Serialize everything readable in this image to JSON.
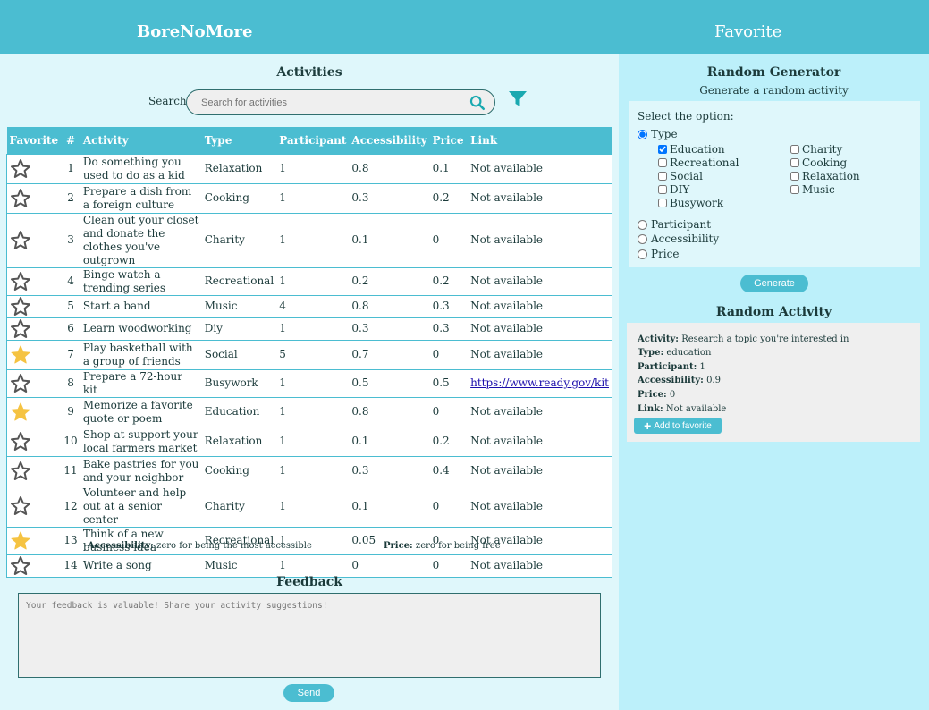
{
  "header": {
    "brand": "BoreNoMore",
    "favorite_link": "Favorite"
  },
  "activities": {
    "title": "Activities",
    "search_label": "Search:",
    "search_placeholder": "Search for activities",
    "columns": [
      "Favorite",
      "#",
      "Activity",
      "Type",
      "Participant",
      "Accessibility",
      "Price",
      "Link"
    ],
    "rows": [
      {
        "fav": false,
        "num": "1",
        "activity": "Do something you used to do as a kid",
        "type": "Relaxation",
        "participant": "1",
        "accessibility": "0.8",
        "price": "0.1",
        "link": "Not available",
        "is_url": false
      },
      {
        "fav": false,
        "num": "2",
        "activity": "Prepare a dish from a foreign culture",
        "type": "Cooking",
        "participant": "1",
        "accessibility": "0.3",
        "price": "0.2",
        "link": "Not available",
        "is_url": false
      },
      {
        "fav": false,
        "num": "3",
        "activity": "Clean out your closet and donate the clothes you've outgrown",
        "type": "Charity",
        "participant": "1",
        "accessibility": "0.1",
        "price": "0",
        "link": "Not available",
        "is_url": false
      },
      {
        "fav": false,
        "num": "4",
        "activity": "Binge watch a trending series",
        "type": "Recreational",
        "participant": "1",
        "accessibility": "0.2",
        "price": "0.2",
        "link": "Not available",
        "is_url": false
      },
      {
        "fav": false,
        "num": "5",
        "activity": "Start a band",
        "type": "Music",
        "participant": "4",
        "accessibility": "0.8",
        "price": "0.3",
        "link": "Not available",
        "is_url": false
      },
      {
        "fav": false,
        "num": "6",
        "activity": "Learn woodworking",
        "type": "Diy",
        "participant": "1",
        "accessibility": "0.3",
        "price": "0.3",
        "link": "Not available",
        "is_url": false
      },
      {
        "fav": true,
        "num": "7",
        "activity": "Play basketball with a group of friends",
        "type": "Social",
        "participant": "5",
        "accessibility": "0.7",
        "price": "0",
        "link": "Not available",
        "is_url": false
      },
      {
        "fav": false,
        "num": "8",
        "activity": "Prepare a 72-hour kit",
        "type": "Busywork",
        "participant": "1",
        "accessibility": "0.5",
        "price": "0.5",
        "link": "https://www.ready.gov/kit",
        "is_url": true
      },
      {
        "fav": true,
        "num": "9",
        "activity": "Memorize a favorite quote or poem",
        "type": "Education",
        "participant": "1",
        "accessibility": "0.8",
        "price": "0",
        "link": "Not available",
        "is_url": false
      },
      {
        "fav": false,
        "num": "10",
        "activity": "Shop at support your local farmers market",
        "type": "Relaxation",
        "participant": "1",
        "accessibility": "0.1",
        "price": "0.2",
        "link": "Not available",
        "is_url": false
      },
      {
        "fav": false,
        "num": "11",
        "activity": "Bake pastries for you and your neighbor",
        "type": "Cooking",
        "participant": "1",
        "accessibility": "0.3",
        "price": "0.4",
        "link": "Not available",
        "is_url": false
      },
      {
        "fav": false,
        "num": "12",
        "activity": "Volunteer and help out at a senior center",
        "type": "Charity",
        "participant": "1",
        "accessibility": "0.1",
        "price": "0",
        "link": "Not available",
        "is_url": false
      },
      {
        "fav": true,
        "num": "13",
        "activity": "Think of a new business idea",
        "type": "Recreational",
        "participant": "1",
        "accessibility": "0.05",
        "price": "0",
        "link": "Not available",
        "is_url": false
      },
      {
        "fav": false,
        "num": "14",
        "activity": "Write a song",
        "type": "Music",
        "participant": "1",
        "accessibility": "0",
        "price": "0",
        "link": "Not available",
        "is_url": false
      }
    ]
  },
  "notes": {
    "accessibility_label": "Accessibility:",
    "accessibility_text": "zero for being the most accessible",
    "price_label": "Price:",
    "price_text": "zero for being free"
  },
  "feedback": {
    "title": "Feedback",
    "placeholder": "Your feedback is valuable! Share your activity suggestions!",
    "send_label": "Send"
  },
  "generator": {
    "title": "Random Generator",
    "subtitle": "Generate a random activity",
    "select_label": "Select the option:",
    "radio_type": "Type",
    "radio_participant": "Participant",
    "radio_accessibility": "Accessibility",
    "radio_price": "Price",
    "type_options": [
      {
        "label": "Education",
        "checked": true
      },
      {
        "label": "Recreational",
        "checked": false
      },
      {
        "label": "Social",
        "checked": false
      },
      {
        "label": "DIY",
        "checked": false
      },
      {
        "label": "Busywork",
        "checked": false
      },
      {
        "label": "Charity",
        "checked": false
      },
      {
        "label": "Cooking",
        "checked": false
      },
      {
        "label": "Relaxation",
        "checked": false
      },
      {
        "label": "Music",
        "checked": false
      }
    ],
    "generate_label": "Generate"
  },
  "random_activity": {
    "title": "Random Activity",
    "activity_label": "Activity:",
    "activity_value": "Research a topic you're interested in",
    "type_label": "Type:",
    "type_value": "education",
    "participant_label": "Participant:",
    "participant_value": "1",
    "accessibility_label": "Accessibility:",
    "accessibility_value": "0.9",
    "price_label": "Price:",
    "price_value": "0",
    "link_label": "Link:",
    "link_value": "Not available",
    "add_label": "Add to favorite"
  },
  "colors": {
    "accent": "#4bbdd1",
    "left_bg": "#dff7fb",
    "right_bg": "#bcf0fa",
    "star_gold": "#f5c342",
    "star_outline": "#555555",
    "filter": "#1aa9b0"
  }
}
